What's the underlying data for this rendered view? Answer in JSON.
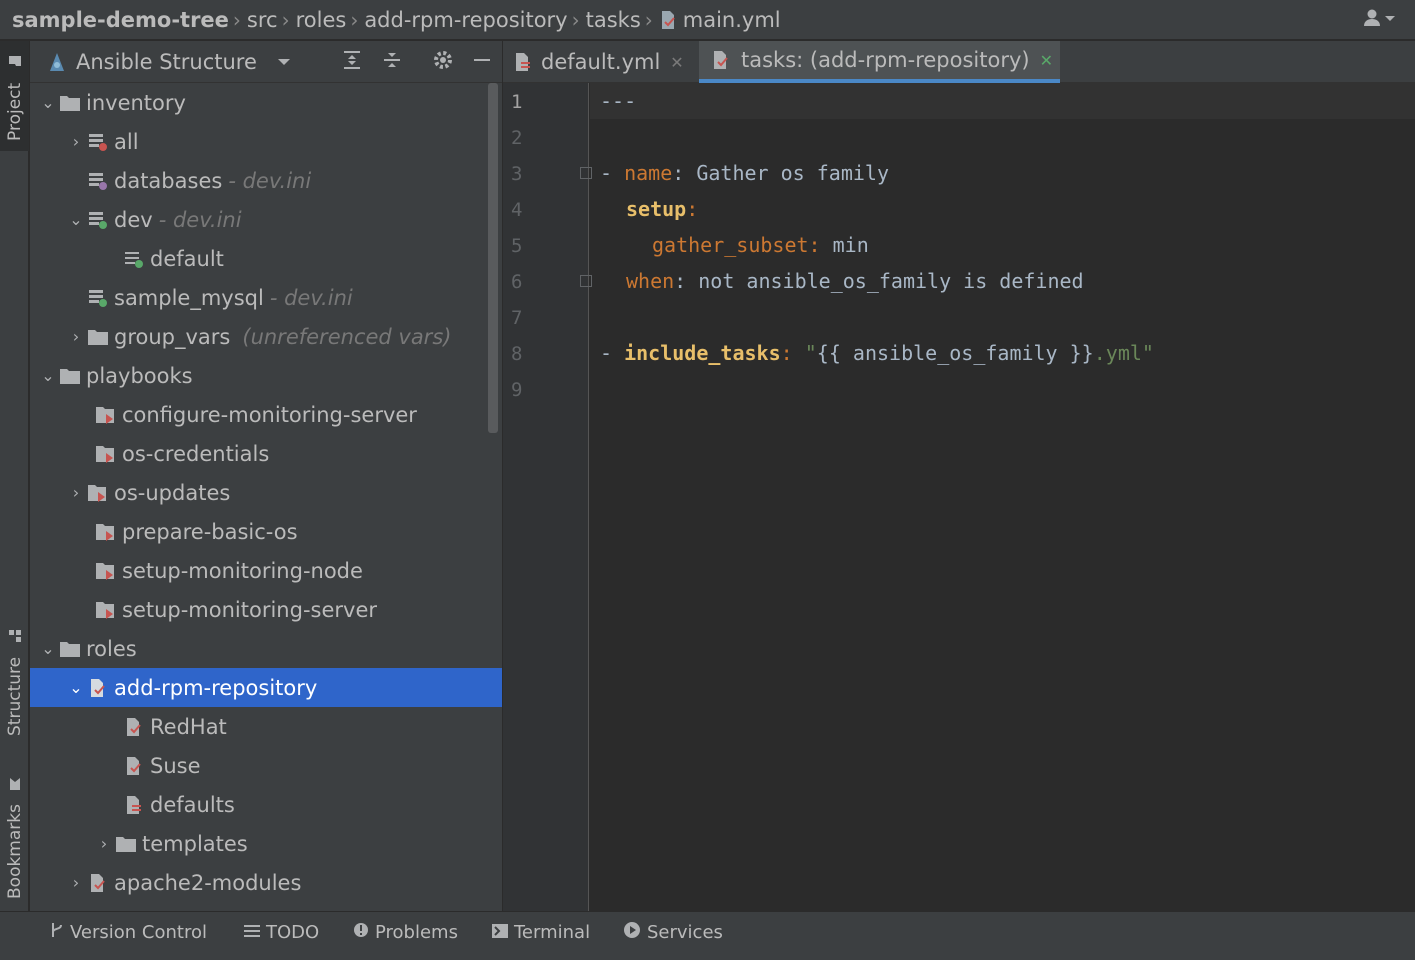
{
  "breadcrumb": {
    "items": [
      "sample-demo-tree",
      "src",
      "roles",
      "add-rpm-repository",
      "tasks",
      "main.yml"
    ]
  },
  "left_strip": {
    "tabs": [
      "Project",
      "Structure",
      "Bookmarks"
    ]
  },
  "panel": {
    "title": "Ansible Structure",
    "tree": [
      {
        "label": "inventory",
        "note": "",
        "icon": "folder-icon",
        "expanded": true
      },
      {
        "label": "all",
        "note": "",
        "icon": "inventory-group-icon",
        "expanded": false
      },
      {
        "label": "databases",
        "note": "- dev.ini",
        "icon": "inventory-group-icon",
        "expanded": null
      },
      {
        "label": "dev",
        "note": "- dev.ini",
        "icon": "inventory-group-icon",
        "expanded": true
      },
      {
        "label": "default",
        "note": "",
        "icon": "host-icon",
        "expanded": null
      },
      {
        "label": "sample_mysql",
        "note": "- dev.ini",
        "icon": "inventory-group-icon",
        "expanded": null
      },
      {
        "label": "group_vars",
        "note": "(unreferenced vars)",
        "icon": "folder-icon",
        "expanded": false
      },
      {
        "label": "playbooks",
        "note": "",
        "icon": "folder-icon",
        "expanded": true
      },
      {
        "label": "configure-monitoring-server",
        "note": "",
        "icon": "playbook-icon",
        "expanded": null
      },
      {
        "label": "os-credentials",
        "note": "",
        "icon": "playbook-icon",
        "expanded": null
      },
      {
        "label": "os-updates",
        "note": "",
        "icon": "playbook-icon",
        "expanded": false
      },
      {
        "label": "prepare-basic-os",
        "note": "",
        "icon": "playbook-icon",
        "expanded": null
      },
      {
        "label": "setup-monitoring-node",
        "note": "",
        "icon": "playbook-icon",
        "expanded": null
      },
      {
        "label": "setup-monitoring-server",
        "note": "",
        "icon": "playbook-icon",
        "expanded": null
      },
      {
        "label": "roles",
        "note": "",
        "icon": "folder-icon",
        "expanded": true
      },
      {
        "label": "add-rpm-repository",
        "note": "",
        "icon": "role-icon",
        "expanded": true,
        "selected": true
      },
      {
        "label": "RedHat",
        "note": "",
        "icon": "tasks-file-icon",
        "expanded": null
      },
      {
        "label": "Suse",
        "note": "",
        "icon": "tasks-file-icon",
        "expanded": null
      },
      {
        "label": "defaults",
        "note": "",
        "icon": "defaults-file-icon",
        "expanded": null
      },
      {
        "label": "templates",
        "note": "",
        "icon": "folder-icon",
        "expanded": false
      },
      {
        "label": "apache2-modules",
        "note": "",
        "icon": "role-icon",
        "expanded": false
      }
    ]
  },
  "editor": {
    "tabs": [
      {
        "label": "default.yml",
        "active": false
      },
      {
        "label": "tasks: (add-rpm-repository)",
        "active": true
      }
    ],
    "line_numbers": [
      "1",
      "2",
      "3",
      "4",
      "5",
      "6",
      "7",
      "8",
      "9"
    ]
  },
  "bottom_tools": [
    {
      "label": "Version Control",
      "icon": "branch-icon"
    },
    {
      "label": "TODO",
      "icon": "list-icon"
    },
    {
      "label": "Problems",
      "icon": "info-icon"
    },
    {
      "label": "Terminal",
      "icon": "terminal-icon"
    },
    {
      "label": "Services",
      "icon": "play-icon"
    }
  ],
  "colors": {
    "selection": "#2f65ca",
    "keyword": "#cc7832",
    "bold_key": "#e8bf6a",
    "string": "#6a8759"
  }
}
